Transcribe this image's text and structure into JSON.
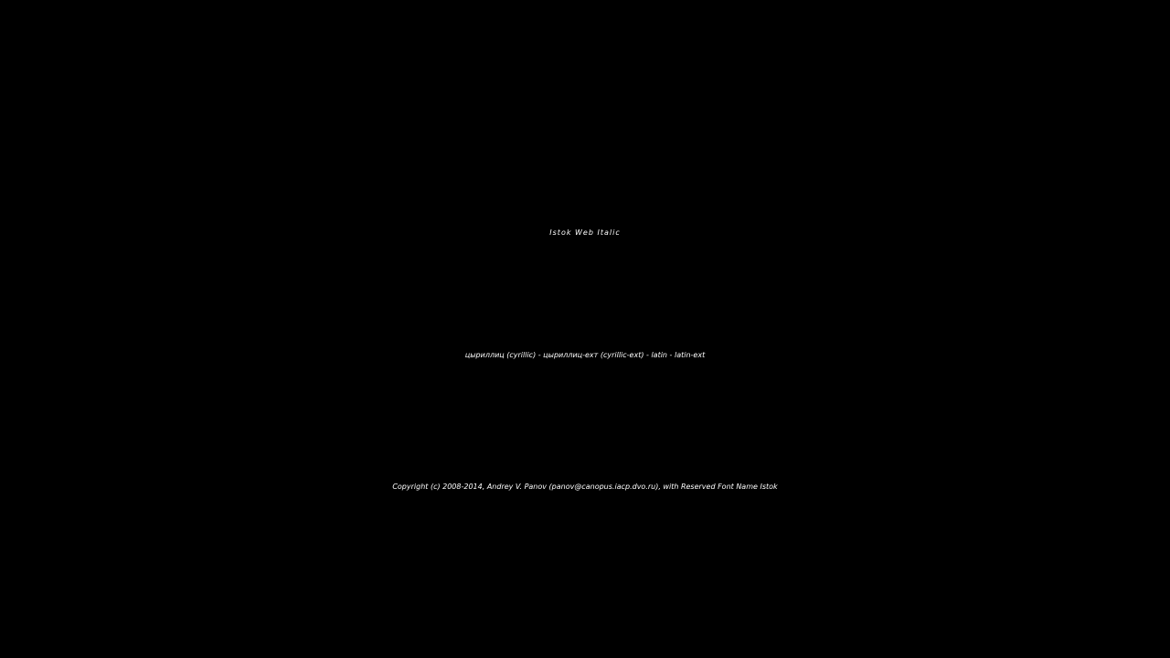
{
  "specimen": {
    "font_name": "Istok Web Italic",
    "subsets": "цыриллиц (cyrillic) - цыриллиц-ехт (cyrillic-ext) - latin - latin-ext",
    "copyright": "Copyright (c) 2008-2014, Andrey V. Panov (panov@canopus.iacp.dvo.ru), with Reserved Font Name Istok"
  },
  "colors": {
    "background": "#000000",
    "text": "#ffffff"
  }
}
